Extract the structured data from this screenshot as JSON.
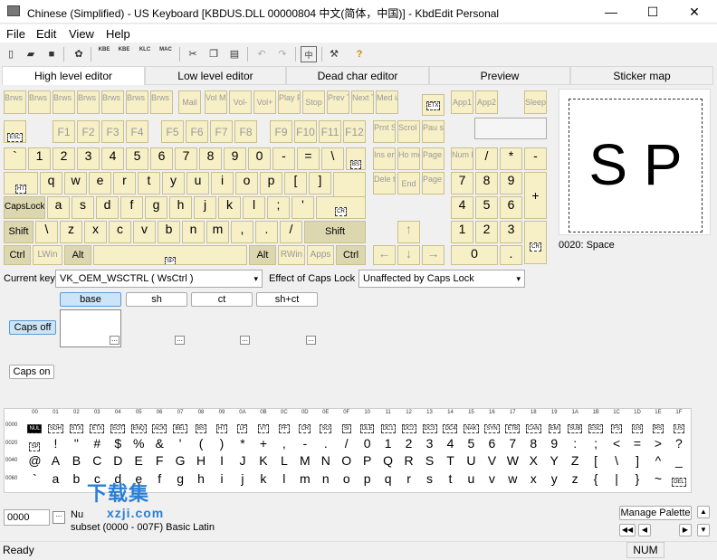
{
  "window": {
    "title": "Chinese (Simplified) - US Keyboard [KBDUS.DLL 00000804 中文(简体，中国)] - KbdEdit Personal",
    "minimize": "—",
    "maximize": "☐",
    "close": "✕"
  },
  "menu": [
    "File",
    "Edit",
    "View",
    "Help"
  ],
  "toolbar": [
    "new-icon",
    "open-icon",
    "save-icon",
    "compile-icon",
    "KBE",
    "KBE",
    "KLC",
    "MAC",
    "cut-icon",
    "copy-icon",
    "paste-icon",
    "undo-icon",
    "redo-icon",
    "ime-icon",
    "tools-icon",
    "help-icon"
  ],
  "tabs": [
    "High level editor",
    "Low level editor",
    "Dead char editor",
    "Preview",
    "Sticker map"
  ],
  "keyboard": {
    "media": [
      "Brws Back",
      "Brws Forw",
      "Brws Stop",
      "Brws Refr",
      "Brws Srch",
      "Brws Fvrt",
      "Brws Home",
      "Mail",
      "Vol Mute",
      "Vol-",
      "Vol+",
      "Play Paus",
      "Stop",
      "Prev Trck",
      "Next Trck",
      "Med ia"
    ],
    "etx": "ETX",
    "app1": "App1",
    "app2": "App2",
    "sleep": "Sleep",
    "esc": "ESC",
    "fkeys": [
      "F1",
      "F2",
      "F3",
      "F4",
      "F5",
      "F6",
      "F7",
      "F8",
      "F9",
      "F10",
      "F11",
      "F12"
    ],
    "prnt": "Prnt Scrn",
    "scroll": "Scrol Lock",
    "pause": "Pau se",
    "row1": [
      "`",
      "1",
      "2",
      "3",
      "4",
      "5",
      "6",
      "7",
      "8",
      "9",
      "0",
      "-",
      "=",
      "\\"
    ],
    "bs": "BS",
    "ins": "Ins ert",
    "home": "Ho me",
    "pgup": "Page Up",
    "numlock": "Num Lock",
    "ndiv": "/",
    "nmul": "*",
    "nsub": "-",
    "ht": "HT",
    "row2": [
      "q",
      "w",
      "e",
      "r",
      "t",
      "y",
      "u",
      "i",
      "o",
      "p",
      "[",
      "]"
    ],
    "del": "Dele te",
    "end": "End",
    "pgdn": "Page Down",
    "n7": "7",
    "n8": "8",
    "n9": "9",
    "nadd": "+",
    "capslock": "CapsLock",
    "row3": [
      "a",
      "s",
      "d",
      "f",
      "g",
      "h",
      "j",
      "k",
      "l",
      ";",
      "'"
    ],
    "cr": "CR",
    "n4": "4",
    "n5": "5",
    "n6": "6",
    "lshift": "Shift",
    "row4": [
      "\\",
      "z",
      "x",
      "c",
      "v",
      "b",
      "n",
      "m",
      ",",
      ".",
      "/"
    ],
    "rshift": "Shift",
    "up": "↑",
    "n1": "1",
    "n2": "2",
    "n3": "3",
    "lctrl": "Ctrl",
    "lwin": "LWin",
    "lalt": "Alt",
    "sp": "SP",
    "ralt": "Alt",
    "rwin": "RWin",
    "apps": "Apps",
    "rctrl": "Ctrl",
    "left": "←",
    "down": "↓",
    "right": "→",
    "n0": "0",
    "ndec": ".",
    "ncr": "CR"
  },
  "preview": {
    "glyph": "S P",
    "caption": "0020: Space"
  },
  "current_key": {
    "label": "Current key",
    "value": "VK_OEM_WSCTRL ( WsCtrl )"
  },
  "caps_effect": {
    "label": "Effect of Caps Lock",
    "value": "Unaffected by Caps Lock"
  },
  "shift_states": [
    "base",
    "sh",
    "ct",
    "sh+ct"
  ],
  "caps_off": "Caps off",
  "caps_on": "Caps on",
  "dots": "...",
  "charmap": {
    "cols": [
      "00",
      "01",
      "02",
      "03",
      "04",
      "05",
      "06",
      "07",
      "08",
      "09",
      "0A",
      "0B",
      "0C",
      "0D",
      "0E",
      "0F",
      "10",
      "11",
      "12",
      "13",
      "14",
      "15",
      "16",
      "17",
      "18",
      "19",
      "1A",
      "1B",
      "1C",
      "1D",
      "1E",
      "1F"
    ],
    "rows": [
      {
        "h": "0000",
        "c": [
          "NUL",
          "SOH",
          "STX",
          "ETX",
          "EOT",
          "ENQ",
          "ACK",
          "BEL",
          "BS",
          "HT",
          "LF",
          "VT",
          "FF",
          "CR",
          "SO",
          "SI",
          "DLE",
          "DC1",
          "DC2",
          "DC3",
          "DC4",
          "NAK",
          "SYN",
          "ETB",
          "CAN",
          "EM",
          "SUB",
          "ESC",
          "FS",
          "GS",
          "RS",
          "US"
        ]
      },
      {
        "h": "0020",
        "c": [
          "SP",
          "!",
          "\"",
          "#",
          "$",
          "%",
          "&",
          "'",
          "(",
          ")",
          "*",
          "+",
          ",",
          "-",
          ".",
          "/",
          "0",
          "1",
          "2",
          "3",
          "4",
          "5",
          "6",
          "7",
          "8",
          "9",
          ":",
          ";",
          "<",
          "=",
          ">",
          "?"
        ]
      },
      {
        "h": "0040",
        "c": [
          "@",
          "A",
          "B",
          "C",
          "D",
          "E",
          "F",
          "G",
          "H",
          "I",
          "J",
          "K",
          "L",
          "M",
          "N",
          "O",
          "P",
          "Q",
          "R",
          "S",
          "T",
          "U",
          "V",
          "W",
          "X",
          "Y",
          "Z",
          "[",
          "\\",
          "]",
          "^",
          "_"
        ]
      },
      {
        "h": "0060",
        "c": [
          "`",
          "a",
          "b",
          "c",
          "d",
          "e",
          "f",
          "g",
          "h",
          "i",
          "j",
          "k",
          "l",
          "m",
          "n",
          "o",
          "p",
          "q",
          "r",
          "s",
          "t",
          "u",
          "v",
          "w",
          "x",
          "y",
          "z",
          "{",
          "|",
          "}",
          "~",
          "DEL"
        ]
      }
    ]
  },
  "code_input": "0000",
  "nu_label": "Nu",
  "subset": "subset (0000 - 007F) Basic Latin",
  "manage_palette": "Manage Palette",
  "watermark": {
    "cn": "下载集",
    "url": "xzji.com"
  },
  "status": {
    "left": "Ready",
    "num": "NUM"
  }
}
